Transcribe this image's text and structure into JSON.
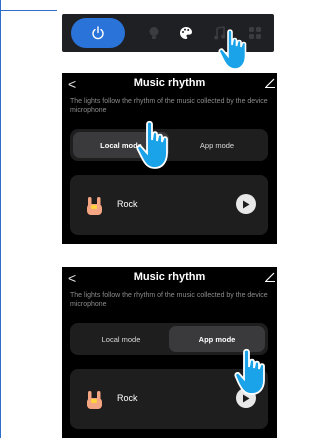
{
  "toolbar": {
    "icons": [
      "power-icon",
      "bulb-icon",
      "palette-icon",
      "music-icon",
      "grid-icon"
    ],
    "accent": "#2a73d9"
  },
  "panels": [
    {
      "back_glyph": "<",
      "title": "Music rhythm",
      "description": "The lights follow the rhythm of the music collected by the device microphone",
      "tabs": [
        "Local mode",
        "App mode"
      ],
      "active_tab": "Local mode",
      "item": {
        "label": "Rock"
      }
    },
    {
      "back_glyph": "<",
      "title": "Music rhythm",
      "description": "The lights follow the rhythm of the music collected by the device microphone",
      "tabs": [
        "Local mode",
        "App mode"
      ],
      "active_tab": "App mode",
      "item": {
        "label": "Rock"
      }
    }
  ],
  "colors": {
    "background": "#000000",
    "card": "#1e1e1f",
    "segment_active": "#3a3a3c",
    "pointer": "#1aa3e8"
  }
}
